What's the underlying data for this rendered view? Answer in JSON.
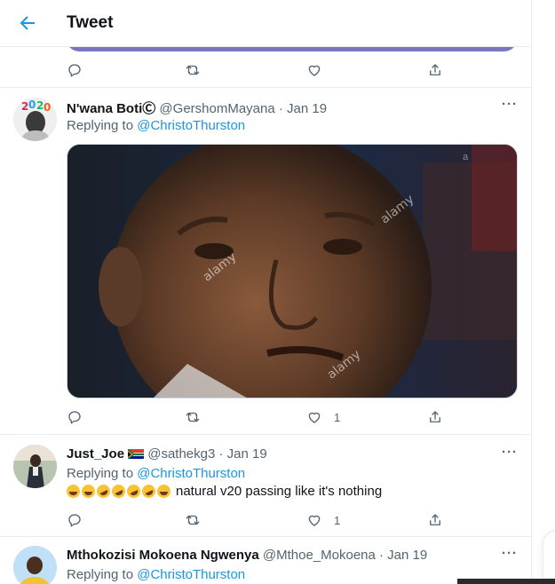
{
  "header": {
    "title": "Tweet",
    "back_icon": "arrow-left-icon"
  },
  "colors": {
    "accent": "#1b95e0",
    "text": "#0f1419",
    "muted": "#536471",
    "border": "#e6ecf0",
    "prev_card": "#7a74c4"
  },
  "previous_tweet": {
    "actions": {
      "like_count": "",
      "retweet_count": "",
      "reply_count": ""
    }
  },
  "tweets": [
    {
      "name": "N'wana BotiⒸ",
      "handle": "@GershomMayana",
      "date": "· Jan 19",
      "replying_prefix": "Replying to ",
      "replying_to": "@ChristoThurston",
      "image_watermarks": [
        "alamy",
        "alamy",
        "alamy",
        "a"
      ],
      "like_count": "1"
    },
    {
      "name": "Just_Joe",
      "handle": "@sathekg3",
      "date": "· Jan 19",
      "replying_prefix": "Replying to ",
      "replying_to": "@ChristoThurston",
      "text": "natural v20 passing like it's nothing",
      "like_count": "1"
    },
    {
      "name": "Mthokozisi Mokoena Ngwenya",
      "handle": "@Mthoe_Mokoena",
      "date": "· Jan 19",
      "replying_prefix": "Replying to ",
      "replying_to": "@ChristoThurston"
    }
  ],
  "more_label": "···"
}
